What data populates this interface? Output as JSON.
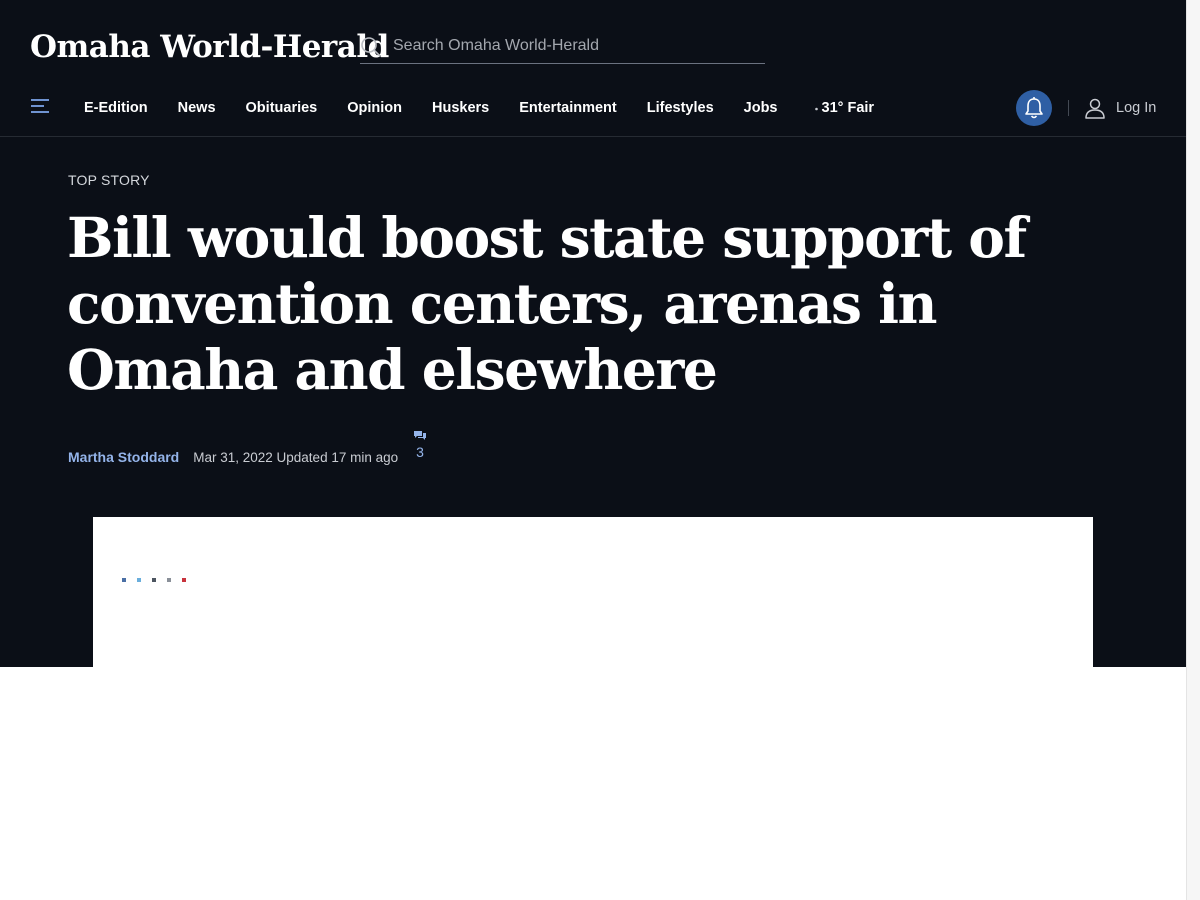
{
  "header": {
    "logo_text": "Omaha World-Herald",
    "search_placeholder": "Search Omaha World-Herald"
  },
  "nav": {
    "items": [
      {
        "label": "E-Edition"
      },
      {
        "label": "News"
      },
      {
        "label": "Obituaries"
      },
      {
        "label": "Opinion"
      },
      {
        "label": "Huskers"
      },
      {
        "label": "Entertainment"
      },
      {
        "label": "Lifestyles"
      },
      {
        "label": "Jobs"
      }
    ],
    "weather": {
      "text": "31° Fair",
      "icon": "weather-icon"
    },
    "notifications_icon": "bell-icon",
    "login_label": "Log In",
    "login_icon": "user-icon",
    "menu_icon": "menu-icon"
  },
  "article": {
    "kicker": "TOP STORY",
    "headline": "Bill would boost state support of convention centers, arenas in Omaha and elsewhere",
    "author": "Martha Stoddard",
    "date": "Mar 31, 2022 Updated 17 min ago",
    "comment_count": "3",
    "comment_icon": "comments-icon"
  },
  "colors": {
    "background": "#0b0f17",
    "accent_link": "#94b4ea",
    "bell_button": "#2f5fa4",
    "loader_dots": [
      "#4a6fa5",
      "#6aaedc",
      "#4c5560",
      "#8a9099",
      "#c8323c"
    ]
  }
}
